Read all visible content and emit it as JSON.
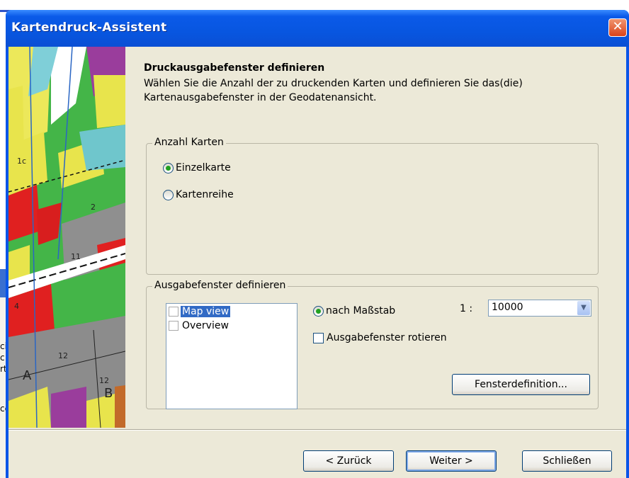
{
  "window": {
    "title": "Kartendruck-Assistent"
  },
  "header": {
    "title": "Druckausgabefenster definieren",
    "description": "Wählen Sie die Anzahl der zu druckenden Karten und definieren Sie das(die) Kartenausgabefenster in der Geodatenansicht."
  },
  "anzahl_karten": {
    "label": "Anzahl Karten",
    "options": [
      {
        "label": "Einzelkarte",
        "selected": true
      },
      {
        "label": "Kartenreihe",
        "selected": false
      }
    ]
  },
  "ausgabefenster": {
    "label": "Ausgabefenster definieren",
    "list": [
      {
        "label": "Map view",
        "checked": false,
        "selected": true
      },
      {
        "label": "Overview",
        "checked": false,
        "selected": false
      }
    ],
    "scale_radio": "nach Maßstab",
    "scale_prefix": "1 :",
    "scale_value": "10000",
    "rotate_label": "Ausgabefenster rotieren",
    "definition_button": "Fensterdefinition..."
  },
  "footer": {
    "back": "< Zurück",
    "next": "Weiter >",
    "close": "Schließen"
  },
  "background": {
    "left_text": [
      "ci",
      "c",
      "rt",
      "ce"
    ]
  },
  "colors": {
    "title_bar": "#0a5ae8",
    "dialog_bg": "#ece9d8",
    "selection": "#316ac5"
  }
}
